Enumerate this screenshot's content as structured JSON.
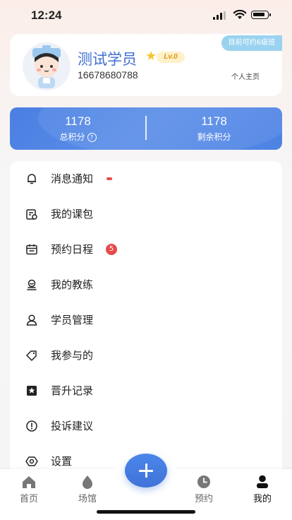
{
  "status_bar": {
    "time": "12:24"
  },
  "profile": {
    "name": "测试学员",
    "level": "Lv.0",
    "phone": "16678680788",
    "class_info": "目前可约6级班",
    "home_link": "个人主页"
  },
  "points": {
    "total_value": "1178",
    "total_label": "总积分",
    "remaining_value": "1178",
    "remaining_label": "剩余积分"
  },
  "menu": [
    {
      "label": "消息通知",
      "icon": "bell-icon"
    },
    {
      "label": "我的课包",
      "icon": "package-icon"
    },
    {
      "label": "预约日程",
      "icon": "calendar-icon",
      "badge": "5"
    },
    {
      "label": "我的教练",
      "icon": "coach-icon"
    },
    {
      "label": "学员管理",
      "icon": "user-icon"
    },
    {
      "label": "我参与的",
      "icon": "tag-icon"
    },
    {
      "label": "晋升记录",
      "icon": "star-icon"
    },
    {
      "label": "投诉建议",
      "icon": "alert-icon"
    },
    {
      "label": "设置",
      "icon": "settings-icon"
    }
  ],
  "tabs": [
    {
      "label": "首页",
      "icon": "home-icon"
    },
    {
      "label": "场馆",
      "icon": "venue-icon"
    },
    {
      "label": "预约",
      "icon": "clock-icon"
    },
    {
      "label": "我的",
      "icon": "person-icon",
      "active": true
    }
  ],
  "colors": {
    "accent": "#4a7fe2",
    "badge": "#e74a4a",
    "name": "#3f6fd1"
  }
}
